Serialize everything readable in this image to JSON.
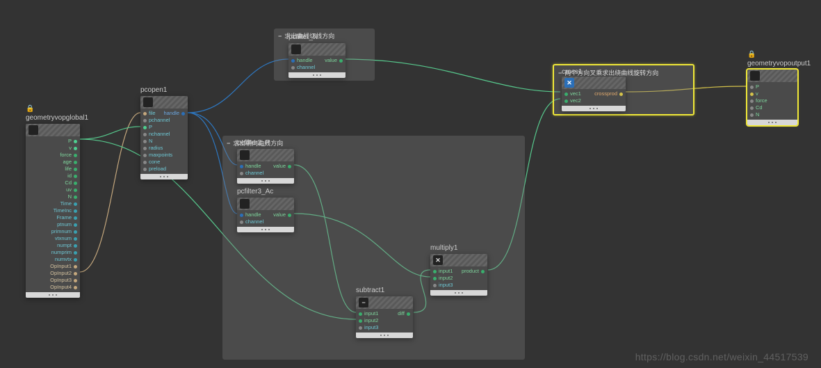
{
  "watermark": "https://blog.csdn.net/weixin_44517539",
  "groups": {
    "group1": {
      "title": "求出曲线切线方向"
    },
    "group2": {
      "title": "求出朝向曲线方向"
    },
    "group3": {
      "title": "两个方向叉乘求出绕曲线旋转方向"
    }
  },
  "nodes": {
    "geomglobal": {
      "title": "geometryvopglobal1",
      "outs": [
        {
          "label": "P",
          "color": "c-green2",
          "tcolor": "txt-green"
        },
        {
          "label": "v",
          "color": "c-green2",
          "tcolor": "txt-green"
        },
        {
          "label": "force",
          "color": "c-green",
          "tcolor": "txt-green"
        },
        {
          "label": "age",
          "color": "c-green",
          "tcolor": "txt-green"
        },
        {
          "label": "life",
          "color": "c-green",
          "tcolor": "txt-green"
        },
        {
          "label": "id",
          "color": "c-green",
          "tcolor": "txt-green"
        },
        {
          "label": "Cd",
          "color": "c-green",
          "tcolor": "txt-green"
        },
        {
          "label": "uv",
          "color": "c-green",
          "tcolor": "txt-green"
        },
        {
          "label": "N",
          "color": "c-green",
          "tcolor": "txt-green"
        },
        {
          "label": "Time",
          "color": "c-cyan",
          "tcolor": "txt-cyan"
        },
        {
          "label": "TimeInc",
          "color": "c-cyan",
          "tcolor": "txt-cyan"
        },
        {
          "label": "Frame",
          "color": "c-cyan",
          "tcolor": "txt-cyan"
        },
        {
          "label": "ptnum",
          "color": "c-cyan",
          "tcolor": "txt-cyan"
        },
        {
          "label": "primnum",
          "color": "c-cyan",
          "tcolor": "txt-cyan"
        },
        {
          "label": "vtxnum",
          "color": "c-cyan",
          "tcolor": "txt-cyan"
        },
        {
          "label": "numpt",
          "color": "c-cyan",
          "tcolor": "txt-cyan"
        },
        {
          "label": "numprim",
          "color": "c-cyan",
          "tcolor": "txt-cyan"
        },
        {
          "label": "numvtx",
          "color": "c-cyan",
          "tcolor": "txt-cyan"
        },
        {
          "label": "OpInput1",
          "color": "c-tan",
          "tcolor": "txt-tan"
        },
        {
          "label": "OpInput2",
          "color": "c-tan",
          "tcolor": "txt-tan"
        },
        {
          "label": "OpInput3",
          "color": "c-tan",
          "tcolor": "txt-tan"
        },
        {
          "label": "OpInput4",
          "color": "c-tan",
          "tcolor": "txt-tan"
        }
      ]
    },
    "pcopen": {
      "title": "pcopen1",
      "ins": [
        {
          "label": "file",
          "color": "c-tan",
          "tcolor": "txt-cyan"
        },
        {
          "label": "pchannel",
          "color": "c-gray",
          "tcolor": "txt-cyan"
        },
        {
          "label": "P",
          "color": "c-green2",
          "tcolor": "txt-cyan"
        },
        {
          "label": "nchannel",
          "color": "c-gray",
          "tcolor": "txt-cyan"
        },
        {
          "label": "N",
          "color": "c-gray",
          "tcolor": "txt-cyan"
        },
        {
          "label": "radius",
          "color": "c-gray",
          "tcolor": "txt-cyan"
        },
        {
          "label": "maxpoints",
          "color": "c-gray",
          "tcolor": "txt-cyan"
        },
        {
          "label": "cone",
          "color": "c-gray",
          "tcolor": "txt-cyan"
        },
        {
          "label": "preload",
          "color": "c-gray",
          "tcolor": "txt-cyan"
        }
      ],
      "outs": [
        {
          "label": "handle",
          "color": "c-blue",
          "tcolor": "txt-blue"
        }
      ]
    },
    "pcfilterN": {
      "title": "pcfilter_N",
      "ins": [
        {
          "label": "handle",
          "color": "c-blue",
          "tcolor": "txt-green"
        },
        {
          "label": "channel",
          "color": "c-gray",
          "tcolor": "txt-cyan"
        }
      ],
      "outs": [
        {
          "label": "value",
          "color": "c-green",
          "tcolor": "txt-green"
        }
      ]
    },
    "pcfilterP": {
      "title": "pcfilter2_P",
      "ins": [
        {
          "label": "handle",
          "color": "c-blue",
          "tcolor": "txt-green"
        },
        {
          "label": "channel",
          "color": "c-gray",
          "tcolor": "txt-cyan"
        }
      ],
      "outs": [
        {
          "label": "value",
          "color": "c-green",
          "tcolor": "txt-green"
        }
      ]
    },
    "pcfilterAc": {
      "title": "pcfilter3_Ac",
      "ins": [
        {
          "label": "handle",
          "color": "c-blue",
          "tcolor": "txt-green"
        },
        {
          "label": "channel",
          "color": "c-gray",
          "tcolor": "txt-cyan"
        }
      ],
      "outs": [
        {
          "label": "value",
          "color": "c-green",
          "tcolor": "txt-green"
        }
      ]
    },
    "subtract": {
      "title": "subtract1",
      "icon": "−",
      "ins": [
        {
          "label": "input1",
          "color": "c-green",
          "tcolor": "txt-green"
        },
        {
          "label": "input2",
          "color": "c-green",
          "tcolor": "txt-green"
        },
        {
          "label": "input3",
          "color": "c-gray",
          "tcolor": "txt-cyan"
        }
      ],
      "outs": [
        {
          "label": "diff",
          "color": "c-green",
          "tcolor": "txt-green"
        }
      ]
    },
    "multiply": {
      "title": "multiply1",
      "icon": "✕",
      "ins": [
        {
          "label": "input1",
          "color": "c-green",
          "tcolor": "txt-green"
        },
        {
          "label": "input2",
          "color": "c-green",
          "tcolor": "txt-green"
        },
        {
          "label": "input3",
          "color": "c-gray",
          "tcolor": "txt-cyan"
        }
      ],
      "outs": [
        {
          "label": "product",
          "color": "c-green",
          "tcolor": "txt-green"
        }
      ]
    },
    "cross": {
      "title": "cross1",
      "icon": "✕",
      "ins": [
        {
          "label": "vec1",
          "color": "c-green",
          "tcolor": "txt-green"
        },
        {
          "label": "vec2",
          "color": "c-green",
          "tcolor": "txt-green"
        }
      ],
      "outs": [
        {
          "label": "crossprod",
          "color": "c-yellow",
          "tcolor": "txt-orange"
        }
      ]
    },
    "geomoutput": {
      "title": "geometryvopoutput1",
      "ins": [
        {
          "label": "P",
          "color": "c-gray",
          "tcolor": "txt-green"
        },
        {
          "label": "v",
          "color": "c-yellow",
          "tcolor": "txt-green"
        },
        {
          "label": "force",
          "color": "c-gray",
          "tcolor": "txt-green"
        },
        {
          "label": "Cd",
          "color": "c-gray",
          "tcolor": "txt-green"
        },
        {
          "label": "N",
          "color": "c-gray",
          "tcolor": "txt-green"
        }
      ]
    }
  }
}
